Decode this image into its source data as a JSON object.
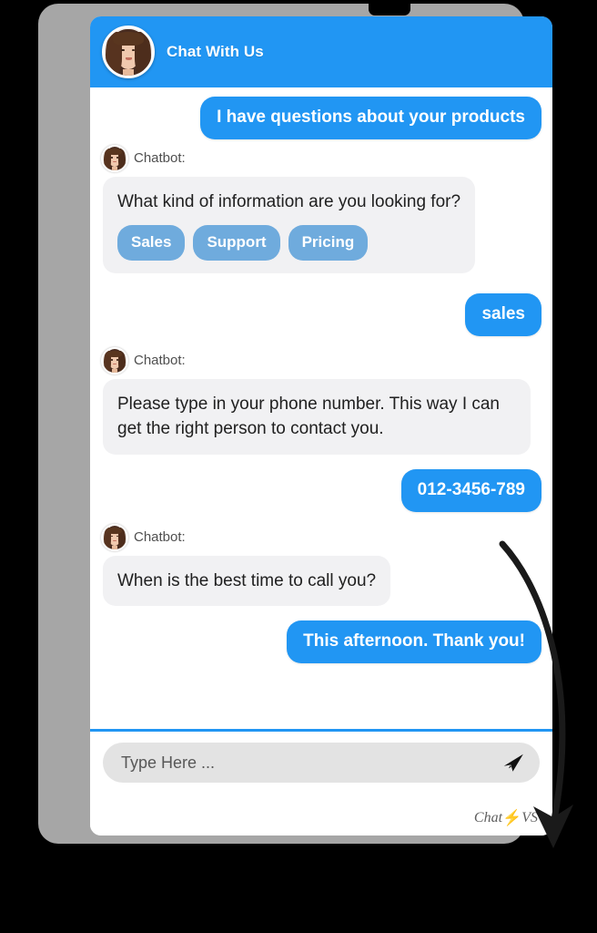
{
  "header": {
    "title": "Chat With Us",
    "avatar_icon": "agent-avatar-photo"
  },
  "conversation": [
    {
      "sender": "user",
      "text": "I have questions about your products"
    },
    {
      "sender": "bot",
      "name": "Chatbot:",
      "text": "What kind of information are you looking for?",
      "quick_replies": [
        "Sales",
        "Support",
        "Pricing"
      ]
    },
    {
      "sender": "user",
      "text": "sales"
    },
    {
      "sender": "bot",
      "name": "Chatbot:",
      "text": "Please type in your phone number. This way I can get the right person to contact you."
    },
    {
      "sender": "user",
      "text": "012-3456-789"
    },
    {
      "sender": "bot",
      "name": "Chatbot:",
      "text": "When is the best time to call you?"
    },
    {
      "sender": "user",
      "text": "This afternoon. Thank you!"
    }
  ],
  "composer": {
    "placeholder": "Type Here ...",
    "value": "",
    "send_icon": "paper-plane-send-icon"
  },
  "branding": {
    "prefix": "Chat",
    "bolt": "⚡",
    "suffix": "VS"
  },
  "annotation": {
    "arrow_icon": "curved-down-arrow"
  },
  "colors": {
    "accent": "#2196f3",
    "chip": "#6fabdd",
    "bot_bubble": "#f1f1f3",
    "frame": "#a6a6a6",
    "background": "#000000",
    "bolt": "#f5a623"
  }
}
